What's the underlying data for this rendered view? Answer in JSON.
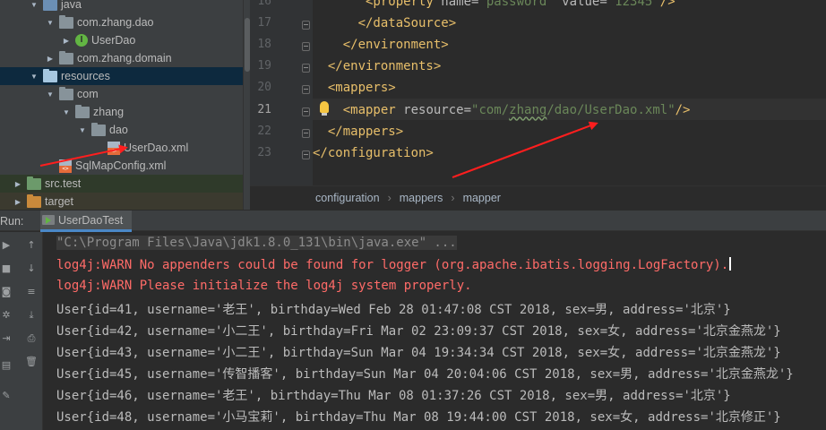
{
  "project_tree": {
    "items": [
      {
        "label": "java",
        "depth": 2,
        "arrow": "down",
        "icon": "folder-src"
      },
      {
        "label": "com.zhang.dao",
        "depth": 3,
        "arrow": "down",
        "icon": "folder"
      },
      {
        "label": "UserDao",
        "depth": 4,
        "arrow": "right",
        "icon": "interface"
      },
      {
        "label": "com.zhang.domain",
        "depth": 3,
        "arrow": "right",
        "icon": "folder"
      },
      {
        "label": "resources",
        "depth": 2,
        "arrow": "down",
        "icon": "folder-res",
        "selected": true
      },
      {
        "label": "com",
        "depth": 3,
        "arrow": "down",
        "icon": "folder"
      },
      {
        "label": "zhang",
        "depth": 4,
        "arrow": "down",
        "icon": "folder"
      },
      {
        "label": "dao",
        "depth": 5,
        "arrow": "down",
        "icon": "folder"
      },
      {
        "label": "UserDao.xml",
        "depth": 6,
        "arrow": "",
        "icon": "xml"
      },
      {
        "label": "SqlMapConfig.xml",
        "depth": 3,
        "arrow": "",
        "icon": "xml"
      },
      {
        "label": "src.test",
        "depth": 1,
        "arrow": "right",
        "icon": "folder-test",
        "tone": "test"
      },
      {
        "label": "target",
        "depth": 1,
        "arrow": "right",
        "icon": "folder-target",
        "tone": "excluded"
      }
    ]
  },
  "editor": {
    "lines": [
      {
        "num": "16",
        "indent": 7,
        "segments": [
          {
            "t": "<property ",
            "k": "tag"
          },
          {
            "t": "name=",
            "k": "attr"
          },
          {
            "t": "\"password\" ",
            "k": "val"
          },
          {
            "t": "value=",
            "k": "attr"
          },
          {
            "t": "\"12345\"",
            "k": "val"
          },
          {
            "t": "/>",
            "k": "tag"
          }
        ]
      },
      {
        "num": "17",
        "indent": 6,
        "segments": [
          {
            "t": "</dataSource>",
            "k": "tag"
          }
        ]
      },
      {
        "num": "18",
        "indent": 4,
        "segments": [
          {
            "t": "</environment>",
            "k": "tag"
          }
        ]
      },
      {
        "num": "19",
        "indent": 2,
        "segments": [
          {
            "t": "</environments>",
            "k": "tag"
          }
        ]
      },
      {
        "num": "20",
        "indent": 2,
        "segments": [
          {
            "t": "<mappers>",
            "k": "tag"
          }
        ]
      },
      {
        "num": "21",
        "indent": 4,
        "current": true,
        "segments": [
          {
            "t": "<mapper ",
            "k": "tag"
          },
          {
            "t": "resource=",
            "k": "attr"
          },
          {
            "t": "\"com/",
            "k": "val"
          },
          {
            "t": "zhang",
            "k": "val-squiggle"
          },
          {
            "t": "/dao/UserDao.xml\"",
            "k": "val"
          },
          {
            "t": "/>",
            "k": "tag"
          }
        ]
      },
      {
        "num": "22",
        "indent": 2,
        "segments": [
          {
            "t": "</mappers>",
            "k": "tag"
          }
        ]
      },
      {
        "num": "23",
        "indent": 0,
        "segments": [
          {
            "t": "</configuration>",
            "k": "tag"
          }
        ]
      }
    ]
  },
  "breadcrumb": [
    "configuration",
    "mappers",
    "mapper"
  ],
  "run_panel": {
    "label": "Run:",
    "tab_label": "UserDaoTest"
  },
  "console": {
    "lines": [
      {
        "text": "\"C:\\Program Files\\Java\\jdk1.8.0_131\\bin\\java.exe\" ...",
        "kind": "cmd"
      },
      {
        "text": "log4j:WARN No appenders could be found for logger (org.apache.ibatis.logging.LogFactory).",
        "kind": "warn",
        "caret": true
      },
      {
        "text": "log4j:WARN Please initialize the log4j system properly.",
        "kind": "warn"
      },
      {
        "text": "User{id=41, username='老王', birthday=Wed Feb 28 01:47:08 CST 2018, sex=男, address='北京'}",
        "kind": "out"
      },
      {
        "text": "User{id=42, username='小二王', birthday=Fri Mar 02 23:09:37 CST 2018, sex=女, address='北京金燕龙'}",
        "kind": "out"
      },
      {
        "text": "User{id=43, username='小二王', birthday=Sun Mar 04 19:34:34 CST 2018, sex=女, address='北京金燕龙'}",
        "kind": "out"
      },
      {
        "text": "User{id=45, username='传智播客', birthday=Sun Mar 04 20:04:06 CST 2018, sex=男, address='北京金燕龙'}",
        "kind": "out"
      },
      {
        "text": "User{id=46, username='老王', birthday=Thu Mar 08 01:37:26 CST 2018, sex=男, address='北京'}",
        "kind": "out"
      },
      {
        "text": "User{id=48, username='小马宝莉', birthday=Thu Mar 08 19:44:00 CST 2018, sex=女, address='北京修正'}",
        "kind": "out"
      }
    ]
  },
  "sidebar_tools": [
    {
      "name": "rerun-icon",
      "glyph": "▶"
    },
    {
      "name": "scroll-up-icon",
      "glyph": "↑"
    },
    {
      "name": "stop-icon",
      "glyph": "■"
    },
    {
      "name": "scroll-down-icon",
      "glyph": "↓"
    },
    {
      "name": "camera-icon",
      "glyph": "◙"
    },
    {
      "name": "soft-wrap-icon",
      "glyph": "≡"
    },
    {
      "name": "settings-icon",
      "glyph": "✲"
    },
    {
      "name": "scroll-to-end-icon",
      "glyph": "⤓"
    },
    {
      "name": "restore-layout-icon",
      "glyph": "⇥"
    },
    {
      "name": "print-icon",
      "glyph": "⎙"
    },
    {
      "name": "layout-icon",
      "glyph": "▤"
    },
    {
      "name": "trash-icon",
      "glyph": "🗑"
    },
    {
      "name": "pin-icon",
      "glyph": "✎"
    }
  ],
  "colors": {
    "tag": "#e8bf6a",
    "attr": "#bababa",
    "value": "#6a8759",
    "warn": "#ff6b68",
    "arrow": "#ff1e1e",
    "selection": "#0d293e"
  }
}
